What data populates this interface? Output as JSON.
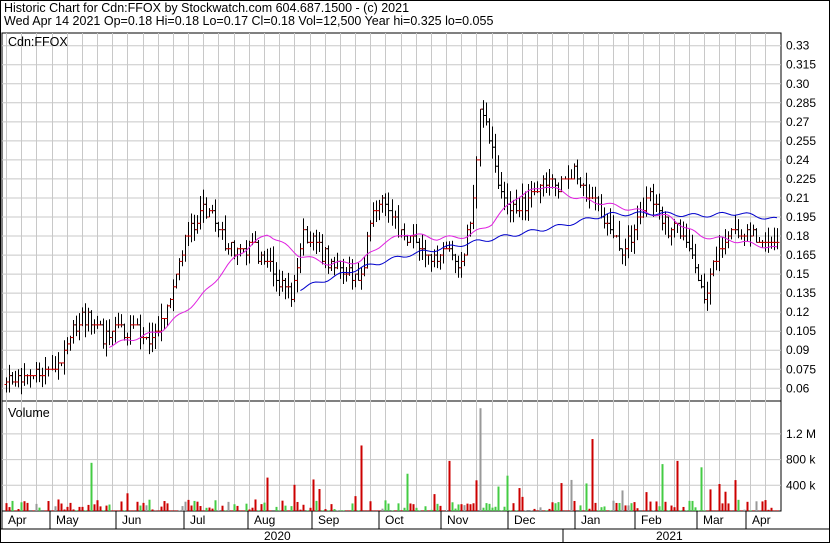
{
  "header": {
    "line1": "Historic Chart for Cdn:FFOX by Stockwatch.com 604.687.1500 - (c) 2021",
    "line2": "Wed Apr 14 2021  Op=0.18  Hi=0.18  Lo=0.17  Cl=0.18  Vol=12,500  Year hi=0.325  lo=0.055"
  },
  "colors": {
    "up": "#cc0000",
    "down": "#000000",
    "ma_short": "#e020e0",
    "ma_long": "#0000cc",
    "vol_up": "#44cc44",
    "vol_down": "#cc0000",
    "vol_flat": "#999999",
    "grid": "#c8c8c8"
  },
  "chart_data": [
    {
      "type": "line",
      "panel": "price",
      "title": "Cdn:FFOX",
      "ylim": [
        0.05,
        0.34
      ],
      "y_ticks": [
        "0.33",
        "0.315",
        "0.30",
        "0.285",
        "0.27",
        "0.255",
        "0.24",
        "0.225",
        "0.21",
        "0.195",
        "0.18",
        "0.165",
        "0.15",
        "0.135",
        "0.12",
        "0.105",
        "0.09",
        "0.075",
        "0.06"
      ],
      "x_ticks": [
        "Apr",
        "May",
        "Jun",
        "Jul",
        "Aug",
        "Sep",
        "Oct",
        "Nov",
        "Dec",
        "Jan",
        "Feb",
        "Mar",
        "Apr"
      ],
      "years": [
        "2020",
        "2021"
      ],
      "price_anchors": [
        {
          "t": 0.0,
          "c": 0.063
        },
        {
          "t": 0.02,
          "c": 0.066
        },
        {
          "t": 0.045,
          "c": 0.072
        },
        {
          "t": 0.07,
          "c": 0.082
        },
        {
          "t": 0.09,
          "c": 0.112
        },
        {
          "t": 0.11,
          "c": 0.115
        },
        {
          "t": 0.13,
          "c": 0.1
        },
        {
          "t": 0.16,
          "c": 0.108
        },
        {
          "t": 0.19,
          "c": 0.098
        },
        {
          "t": 0.21,
          "c": 0.13
        },
        {
          "t": 0.225,
          "c": 0.16
        },
        {
          "t": 0.24,
          "c": 0.19
        },
        {
          "t": 0.26,
          "c": 0.2
        },
        {
          "t": 0.28,
          "c": 0.18
        },
        {
          "t": 0.3,
          "c": 0.165
        },
        {
          "t": 0.32,
          "c": 0.172
        },
        {
          "t": 0.34,
          "c": 0.155
        },
        {
          "t": 0.355,
          "c": 0.14
        },
        {
          "t": 0.37,
          "c": 0.135
        },
        {
          "t": 0.385,
          "c": 0.18
        },
        {
          "t": 0.4,
          "c": 0.175
        },
        {
          "t": 0.42,
          "c": 0.16
        },
        {
          "t": 0.44,
          "c": 0.155
        },
        {
          "t": 0.46,
          "c": 0.145
        },
        {
          "t": 0.475,
          "c": 0.2
        },
        {
          "t": 0.49,
          "c": 0.21
        },
        {
          "t": 0.51,
          "c": 0.185
        },
        {
          "t": 0.53,
          "c": 0.175
        },
        {
          "t": 0.55,
          "c": 0.16
        },
        {
          "t": 0.57,
          "c": 0.168
        },
        {
          "t": 0.59,
          "c": 0.155
        },
        {
          "t": 0.605,
          "c": 0.2
        },
        {
          "t": 0.615,
          "c": 0.29
        },
        {
          "t": 0.625,
          "c": 0.26
        },
        {
          "t": 0.64,
          "c": 0.215
        },
        {
          "t": 0.66,
          "c": 0.2
        },
        {
          "t": 0.68,
          "c": 0.21
        },
        {
          "t": 0.7,
          "c": 0.225
        },
        {
          "t": 0.72,
          "c": 0.22
        },
        {
          "t": 0.735,
          "c": 0.235
        },
        {
          "t": 0.75,
          "c": 0.215
        },
        {
          "t": 0.77,
          "c": 0.2
        },
        {
          "t": 0.79,
          "c": 0.18
        },
        {
          "t": 0.8,
          "c": 0.165
        },
        {
          "t": 0.82,
          "c": 0.195
        },
        {
          "t": 0.835,
          "c": 0.215
        },
        {
          "t": 0.85,
          "c": 0.19
        },
        {
          "t": 0.87,
          "c": 0.185
        },
        {
          "t": 0.89,
          "c": 0.17
        },
        {
          "t": 0.905,
          "c": 0.135
        },
        {
          "t": 0.92,
          "c": 0.16
        },
        {
          "t": 0.935,
          "c": 0.18
        },
        {
          "t": 0.955,
          "c": 0.185
        },
        {
          "t": 0.975,
          "c": 0.175
        },
        {
          "t": 1.0,
          "c": 0.18
        }
      ],
      "ma_short_anchors": [
        {
          "t": 0.13,
          "v": 0.093
        },
        {
          "t": 0.2,
          "v": 0.105
        },
        {
          "t": 0.25,
          "v": 0.13
        },
        {
          "t": 0.3,
          "v": 0.165
        },
        {
          "t": 0.34,
          "v": 0.182
        },
        {
          "t": 0.38,
          "v": 0.165
        },
        {
          "t": 0.42,
          "v": 0.158
        },
        {
          "t": 0.46,
          "v": 0.16
        },
        {
          "t": 0.49,
          "v": 0.175
        },
        {
          "t": 0.52,
          "v": 0.182
        },
        {
          "t": 0.56,
          "v": 0.178
        },
        {
          "t": 0.6,
          "v": 0.18
        },
        {
          "t": 0.63,
          "v": 0.19
        },
        {
          "t": 0.66,
          "v": 0.21
        },
        {
          "t": 0.7,
          "v": 0.22
        },
        {
          "t": 0.74,
          "v": 0.21
        },
        {
          "t": 0.78,
          "v": 0.205
        },
        {
          "t": 0.82,
          "v": 0.2
        },
        {
          "t": 0.86,
          "v": 0.195
        },
        {
          "t": 0.9,
          "v": 0.18
        },
        {
          "t": 0.94,
          "v": 0.177
        },
        {
          "t": 1.0,
          "v": 0.17
        }
      ],
      "ma_long_anchors": [
        {
          "t": 0.38,
          "v": 0.138
        },
        {
          "t": 0.45,
          "v": 0.153
        },
        {
          "t": 0.52,
          "v": 0.165
        },
        {
          "t": 0.58,
          "v": 0.172
        },
        {
          "t": 0.65,
          "v": 0.18
        },
        {
          "t": 0.72,
          "v": 0.188
        },
        {
          "t": 0.78,
          "v": 0.197
        },
        {
          "t": 0.84,
          "v": 0.198
        },
        {
          "t": 0.9,
          "v": 0.196
        },
        {
          "t": 0.95,
          "v": 0.198
        },
        {
          "t": 1.0,
          "v": 0.193
        }
      ],
      "n_bars": 255
    },
    {
      "type": "bar",
      "panel": "volume",
      "title": "Volume",
      "ylim": [
        0,
        1.65
      ],
      "y_ticks": [
        "1.2 M",
        "800 k",
        "400 k"
      ],
      "spikes": [
        {
          "t": 0.112,
          "v": 0.75
        },
        {
          "t": 0.34,
          "v": 0.52
        },
        {
          "t": 0.46,
          "v": 1.02
        },
        {
          "t": 0.52,
          "v": 0.58
        },
        {
          "t": 0.575,
          "v": 0.78
        },
        {
          "t": 0.615,
          "v": 1.6
        },
        {
          "t": 0.65,
          "v": 0.55
        },
        {
          "t": 0.76,
          "v": 1.12
        },
        {
          "t": 0.8,
          "v": 0.32
        },
        {
          "t": 0.85,
          "v": 0.73
        },
        {
          "t": 0.87,
          "v": 0.78
        },
        {
          "t": 0.9,
          "v": 0.68
        },
        {
          "t": 0.925,
          "v": 0.42
        },
        {
          "t": 0.935,
          "v": 0.3
        }
      ]
    }
  ]
}
